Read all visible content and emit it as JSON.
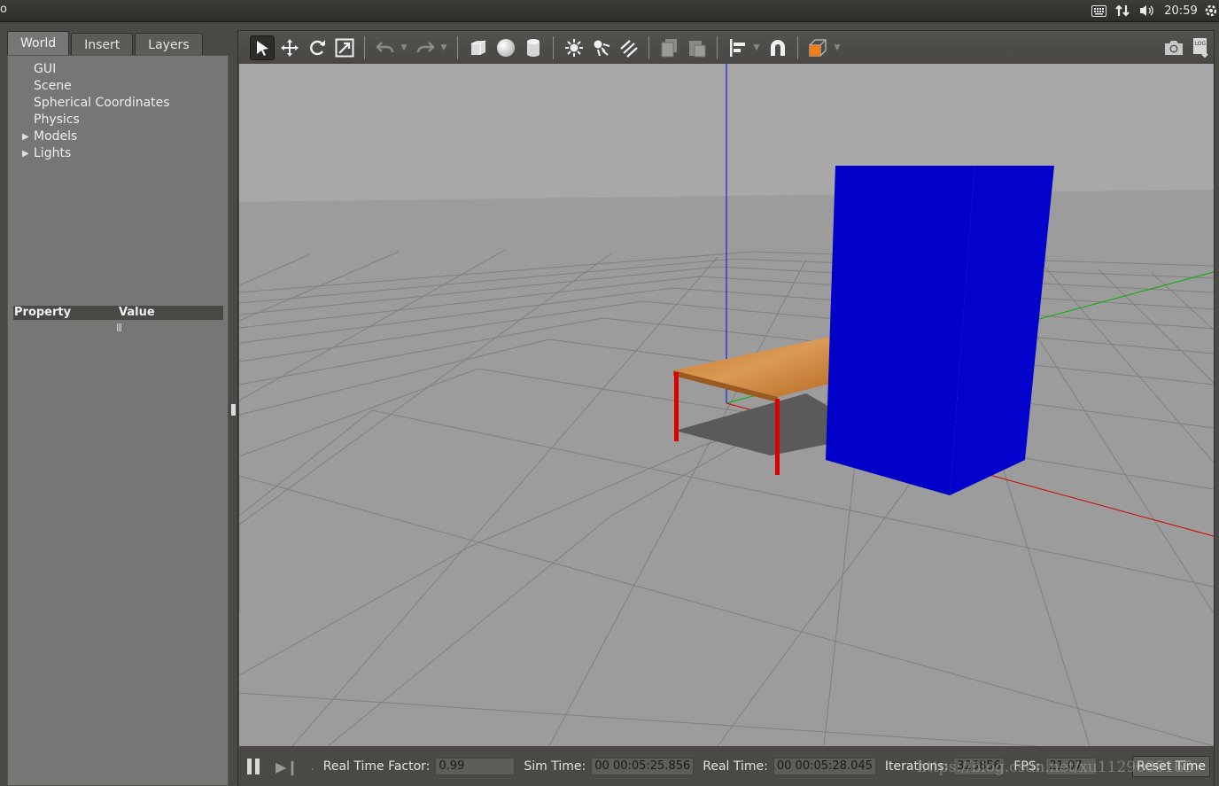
{
  "topbar": {
    "app_letter": "o",
    "tray": {
      "keyboard_icon": "keyboard-icon",
      "network_icon": "network-updown-icon",
      "volume_icon": "volume-icon",
      "clock": "20:59",
      "settings_icon": "gear-icon"
    }
  },
  "left_panel": {
    "tabs": [
      "World",
      "Insert",
      "Layers"
    ],
    "active_tab": "World",
    "tree": [
      {
        "label": "GUI",
        "expandable": false
      },
      {
        "label": "Scene",
        "expandable": false
      },
      {
        "label": "Spherical Coordinates",
        "expandable": false
      },
      {
        "label": "Physics",
        "expandable": false
      },
      {
        "label": "Models",
        "expandable": true
      },
      {
        "label": "Lights",
        "expandable": true
      }
    ],
    "property_header": {
      "property": "Property",
      "value": "Value"
    }
  },
  "toolbar": {
    "tools": [
      "select-arrow-icon",
      "translate-icon",
      "rotate-icon",
      "scale-icon",
      "undo-icon",
      "redo-icon",
      "box-icon",
      "sphere-icon",
      "cylinder-icon",
      "point-light-icon",
      "spot-light-icon",
      "directional-light-icon",
      "copy-icon",
      "paste-icon",
      "align-icon",
      "snap-magnet-icon",
      "view-angle-icon",
      "screenshot-camera-icon",
      "log-icon"
    ],
    "log_label": "LOG"
  },
  "scene": {
    "sky_color": "#a8a8a8",
    "ground_color": "#9c9c9c",
    "grid_color": "#7e7e7e",
    "box_color": "#0000c8",
    "table_top_color": "#c8782c",
    "table_leg_color": "#dc0000",
    "axis_colors": {
      "x": "#d00000",
      "y": "#00b000",
      "z": "#0000ff"
    }
  },
  "statusbar": {
    "real_time_factor_label": "Real Time Factor:",
    "real_time_factor": "0.99",
    "sim_time_label": "Sim Time:",
    "sim_time": "00 00:05:25.856",
    "real_time_label": "Real Time:",
    "real_time": "00 00:05:28.045",
    "iterations_label": "Iterations:",
    "iterations": "325856",
    "fps_label": "FPS:",
    "fps": "21.07",
    "reset_time_label": "Reset Time"
  },
  "watermark": "https://blog.csdn.net/xu1129005165"
}
